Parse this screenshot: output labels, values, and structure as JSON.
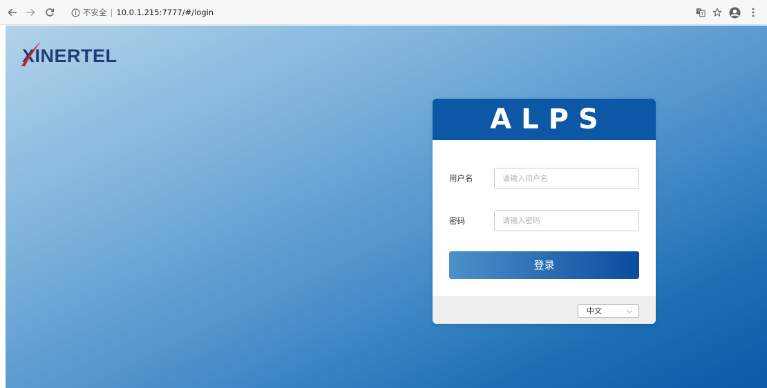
{
  "browser": {
    "nav": {
      "back_icon": "arrow-left-icon",
      "forward_icon": "arrow-right-icon",
      "reload_icon": "reload-icon"
    },
    "address": {
      "info_icon": "info-icon",
      "security_label": "不安全",
      "separator": "|",
      "url": "10.0.1.215:7777/#/login"
    },
    "toolbar": {
      "translate_icon": "translate-icon",
      "bookmark_icon": "star-icon",
      "profile_icon": "account-icon",
      "menu_icon": "more-vert-icon"
    }
  },
  "logo": {
    "text": "XINERTEL"
  },
  "login": {
    "title": "ALPS",
    "username": {
      "label": "用户名",
      "placeholder": "请输入用户名",
      "value": ""
    },
    "password": {
      "label": "密码",
      "placeholder": "请输入密码",
      "value": ""
    },
    "submit_label": "登录",
    "language": {
      "selected": "中文",
      "chevron_icon": "chevron-down-icon"
    }
  },
  "theme": {
    "header_blue": "#0c57a6",
    "button_start": "#4c91c9",
    "button_end": "#0a4c9e",
    "logo_navy": "#1f3d72",
    "logo_red": "#cc1f2f"
  }
}
